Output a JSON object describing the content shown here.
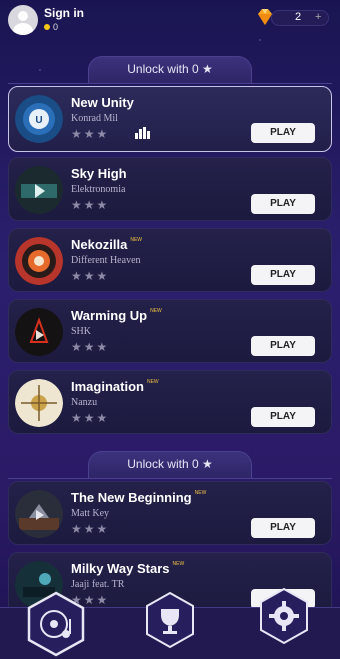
{
  "header": {
    "signin_label": "Sign in",
    "coins": "0",
    "gems": "2",
    "plus_label": "+"
  },
  "sections": [
    {
      "unlock_label": "Unlock with 0 ★"
    },
    {
      "unlock_label": "Unlock with 0 ★"
    }
  ],
  "songs": [
    {
      "title": "New Unity",
      "artist": "Konrad Mil",
      "stars": "★★★",
      "play": "PLAY",
      "is_new": ""
    },
    {
      "title": "Sky High",
      "artist": "Elektronomia",
      "stars": "★★★",
      "play": "PLAY",
      "is_new": ""
    },
    {
      "title": "Nekozilla",
      "artist": "Different Heaven",
      "stars": "★★★",
      "play": "PLAY",
      "is_new": "NEW"
    },
    {
      "title": "Warming Up",
      "artist": "SHK",
      "stars": "★★★",
      "play": "PLAY",
      "is_new": "NEW"
    },
    {
      "title": "Imagination",
      "artist": "Nanzu",
      "stars": "★★★",
      "play": "PLAY",
      "is_new": "NEW"
    },
    {
      "title": "The New Beginning",
      "artist": "Matt Key",
      "stars": "★★★",
      "play": "PLAY",
      "is_new": "NEW"
    },
    {
      "title": "Milky Way Stars",
      "artist": "Jaaji feat. TR",
      "stars": "★★★",
      "play": "",
      "is_new": "NEW"
    }
  ],
  "nav": {
    "items": [
      "songs-icon",
      "trophy-icon",
      "gear-icon"
    ]
  },
  "colors": {
    "accent": "#f5c518",
    "background": "#2a1f6e",
    "play_button": "#f4f4f6"
  }
}
